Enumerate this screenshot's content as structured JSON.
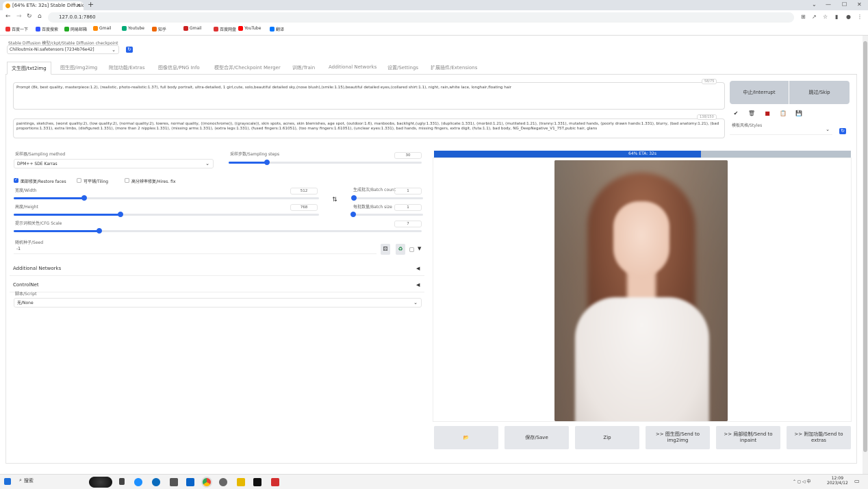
{
  "browser": {
    "tab_title": "[64% ETA: 32s] Stable Diffusion",
    "url": "127.0.0.1:7860",
    "bookmarks": [
      "百度一下",
      "百度搜索",
      "网易邮箱",
      "Gmail",
      "Youtube",
      "知乎",
      "Gmail",
      "百度网盘",
      "YouTube",
      "翻译"
    ]
  },
  "checkpoint": {
    "label": "Stable Diffusion 模型/ckpt/Stable Diffusion checkpoint",
    "value": "Chilloutmix-Ni.safetensors [7234b76e42]"
  },
  "tabs": [
    "文生图/txt2img",
    "图生图/img2img",
    "附加功能/Extras",
    "图像信息/PNG Info",
    "模型合并/Checkpoint Merger",
    "训练/Train",
    "Additional Networks",
    "设置/Settings",
    "扩展插件/Extensions"
  ],
  "prompt": {
    "text": "Prompt (8k, best quality, masterpiece:1.2), (realistic, photo-realistic:1.37), full body portrait, ultra-detailed, 1 girl,cute, solo,beautiful detailed sky,(nose blush),(smile:1.15),beautiful detailed eyes,(collared shirt:1.1), night, rain,white lace, longhair,floating hair",
    "counter": "58/75"
  },
  "negative_prompt": {
    "text": "paintings, sketches, (worst quality:2), (low quality:2), (normal quality:2), lowres, normal quality, ((monochrome)), ((grayscale)), skin spots, acnes, skin blemishes, age spot, (outdoor:1.6), manboobs, backlight,(ugly:1.331), (duplicate:1.331), (morbid:1.21), (mutilated:1.21), (tranny:1.331), mutated hands, (poorly drawn hands:1.331), blurry, (bad anatomy:1.21), (bad proportions:1.331), extra limbs, (disfigured:1.331), (more than 2 nipples:1.331), (missing arms:1.331), (extra legs:1.331), (fused fingers:1.61051), (too many fingers:1.61051), (unclear eyes:1.331), bad hands, missing fingers, extra digit, (futa:1.1), bad body, NG_DeepNegative_V1_75T,pubic hair, glans",
    "counter": "138/150"
  },
  "buttons": {
    "interrupt": "中止/Interrupt",
    "skip": "跳过/Skip",
    "styles_label": "模板风格/Styles"
  },
  "toolbar_icons": [
    "check-icon",
    "trash-icon",
    "book-icon",
    "clipboard-icon",
    "save-icon"
  ],
  "sampling": {
    "method_label": "采样器/Sampling method",
    "method_value": "DPM++ SDE Karras",
    "steps_label": "采样步数/Sampling steps",
    "steps_value": "30",
    "steps_fraction": 0.2
  },
  "options": {
    "restore_faces": "面部修复/Restore faces",
    "restore_faces_checked": true,
    "tiling": "可平铺/Tiling",
    "hires": "高分辨率修复/Hires. fix"
  },
  "width": {
    "label": "宽度/Width",
    "value": "512",
    "fraction": 0.23
  },
  "height": {
    "label": "高度/Height",
    "value": "768",
    "fraction": 0.35
  },
  "swap_icon": "⇅",
  "batch_count": {
    "label": "生成批次/Batch count",
    "value": "1",
    "fraction": 0.01
  },
  "batch_size": {
    "label": "每批数量/Batch size",
    "value": "1",
    "fraction": 0.0
  },
  "cfg": {
    "label": "提示词相关性/CFG Scale",
    "value": "7",
    "fraction": 0.21
  },
  "seed": {
    "label": "随机种子/Seed",
    "value": "-1"
  },
  "additional_networks": "Additional Networks",
  "controlnet": "ControlNet",
  "script": {
    "label": "脚本/Script",
    "value": "无/None"
  },
  "progress": {
    "text": "64% ETA: 32s",
    "fraction": 0.64
  },
  "actions": [
    "📂",
    "保存/Save",
    "Zip",
    ">> 图生图/Send to img2img",
    ">> 局部绘制/Send to inpaint",
    ">> 附加功能/Send to extras"
  ],
  "taskbar": {
    "search": "搜索",
    "time": "12:09",
    "date": "2023/4/12"
  }
}
